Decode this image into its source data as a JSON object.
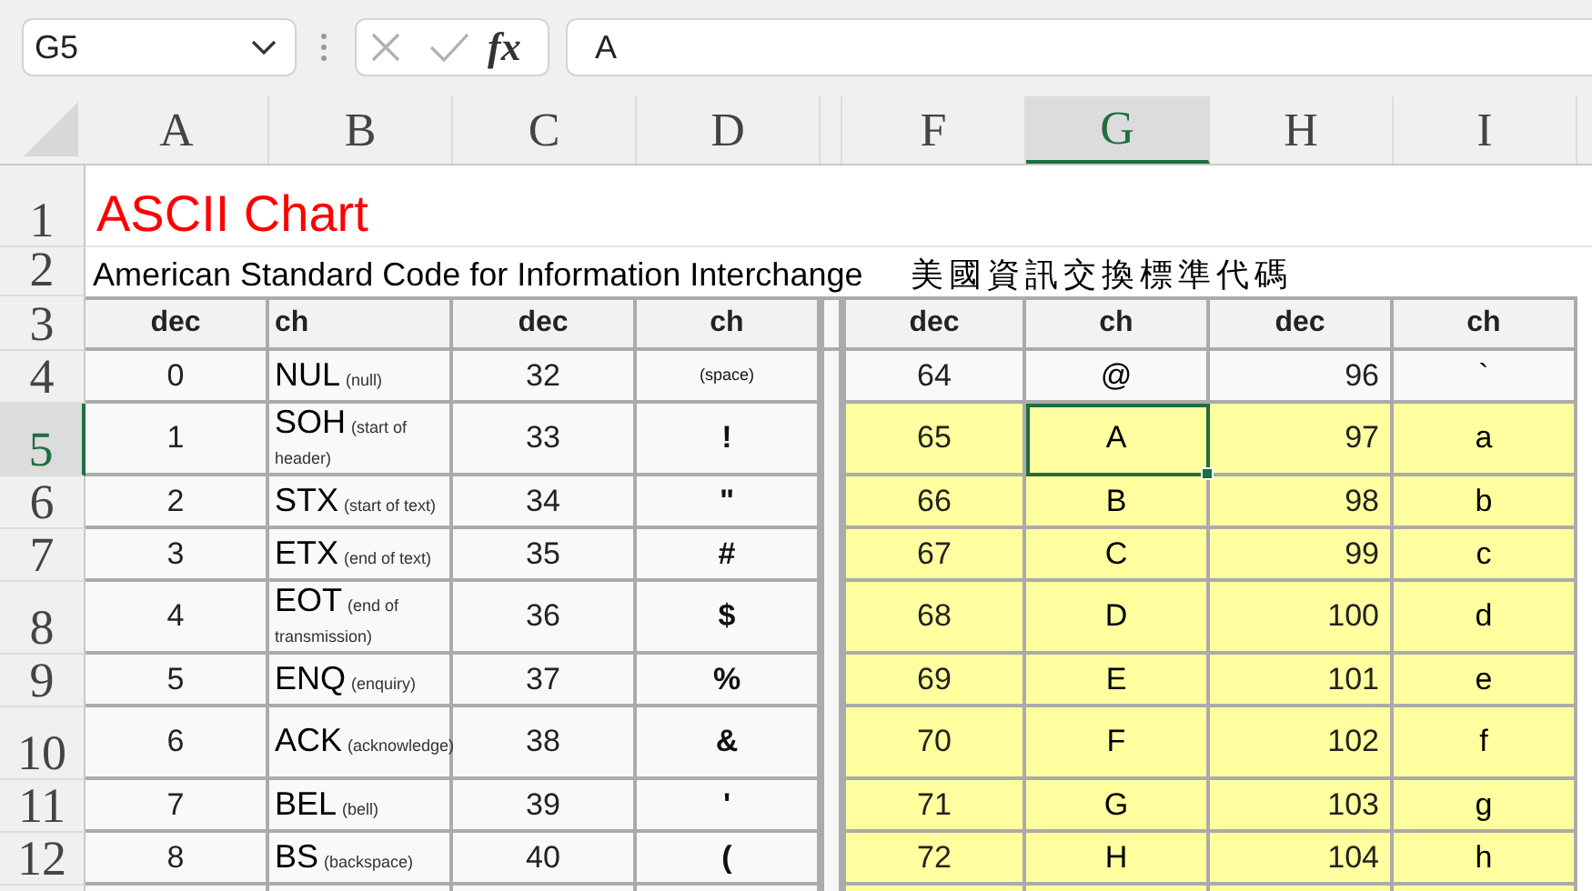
{
  "formula_bar": {
    "name_box": "G5",
    "function_button": "fx",
    "formula": "A"
  },
  "column_headers": [
    {
      "label": "A",
      "selected": false
    },
    {
      "label": "B",
      "selected": false
    },
    {
      "label": "C",
      "selected": false
    },
    {
      "label": "D",
      "selected": false
    },
    {
      "label": "F",
      "selected": false
    },
    {
      "label": "G",
      "selected": true
    },
    {
      "label": "H",
      "selected": false
    },
    {
      "label": "I",
      "selected": false
    }
  ],
  "row_headers": [
    {
      "label": "1",
      "selected": false
    },
    {
      "label": "2",
      "selected": false
    },
    {
      "label": "3",
      "selected": false
    },
    {
      "label": "4",
      "selected": false
    },
    {
      "label": "5",
      "selected": true
    },
    {
      "label": "6",
      "selected": false
    },
    {
      "label": "7",
      "selected": false
    },
    {
      "label": "8",
      "selected": false
    },
    {
      "label": "9",
      "selected": false
    },
    {
      "label": "10",
      "selected": false
    },
    {
      "label": "11",
      "selected": false
    },
    {
      "label": "12",
      "selected": false
    }
  ],
  "title": "ASCII Chart",
  "subtitle": "American Standard Code for Information Interchange",
  "subtitle_chinese": "美國資訊交換標準代碼",
  "left_headers": [
    "dec",
    "ch",
    "dec",
    "ch"
  ],
  "right_headers": [
    "dec",
    "ch",
    "dec",
    "ch"
  ],
  "left_rows": [
    {
      "dec": "0",
      "code": "NUL",
      "description": "(null)",
      "dec_2": "32",
      "ch": "(space)"
    },
    {
      "dec": "1",
      "code": "SOH",
      "description": "(start of header)",
      "dec_2": "33",
      "ch": "!"
    },
    {
      "dec": "2",
      "code": "STX",
      "description": "(start of text)",
      "dec_2": "34",
      "ch": "\""
    },
    {
      "dec": "3",
      "code": "ETX",
      "description": "(end of text)",
      "dec_2": "35",
      "ch": "#"
    },
    {
      "dec": "4",
      "code": "EOT",
      "description": "(end of transmission)",
      "dec_2": "36",
      "ch": "$"
    },
    {
      "dec": "5",
      "code": "ENQ",
      "description": "(enquiry)",
      "dec_2": "37",
      "ch": "%"
    },
    {
      "dec": "6",
      "code": "ACK",
      "description": "(acknowledge)",
      "dec_2": "38",
      "ch": "&"
    },
    {
      "dec": "7",
      "code": "BEL",
      "description": "(bell)",
      "dec_2": "39",
      "ch": "'"
    },
    {
      "dec": "8",
      "code": "BS",
      "description": "(backspace)",
      "dec_2": "40",
      "ch": "("
    }
  ],
  "right_rows": [
    {
      "dec": "64",
      "ch": "@",
      "dec_2": "96",
      "ch_2": "`",
      "highlighted": false,
      "selected": false
    },
    {
      "dec": "65",
      "ch": "A",
      "dec_2": "97",
      "ch_2": "a",
      "highlighted": true,
      "selected": true
    },
    {
      "dec": "66",
      "ch": "B",
      "dec_2": "98",
      "ch_2": "b",
      "highlighted": true,
      "selected": false
    },
    {
      "dec": "67",
      "ch": "C",
      "dec_2": "99",
      "ch_2": "c",
      "highlighted": true,
      "selected": false
    },
    {
      "dec": "68",
      "ch": "D",
      "dec_2": "100",
      "ch_2": "d",
      "highlighted": true,
      "selected": false
    },
    {
      "dec": "69",
      "ch": "E",
      "dec_2": "101",
      "ch_2": "e",
      "highlighted": true,
      "selected": false
    },
    {
      "dec": "70",
      "ch": "F",
      "dec_2": "102",
      "ch_2": "f",
      "highlighted": true,
      "selected": false
    },
    {
      "dec": "71",
      "ch": "G",
      "dec_2": "103",
      "ch_2": "g",
      "highlighted": true,
      "selected": false
    },
    {
      "dec": "72",
      "ch": "H",
      "dec_2": "104",
      "ch_2": "h",
      "highlighted": true,
      "selected": false
    }
  ]
}
